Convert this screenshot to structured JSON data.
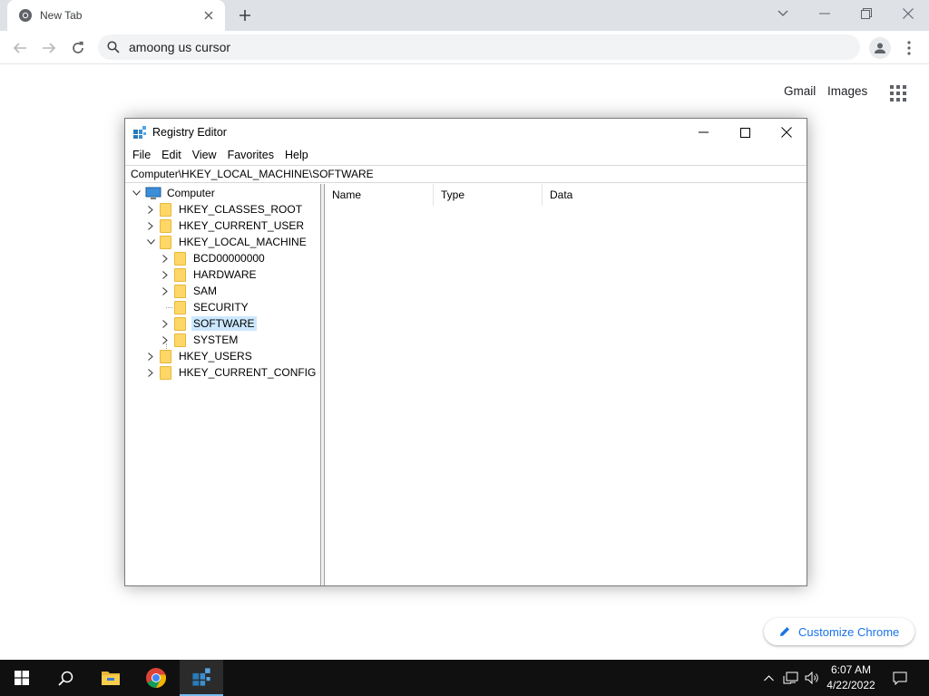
{
  "browser": {
    "tab_title": "New Tab",
    "omnibox_text": "amoong us cursor",
    "ntp": {
      "gmail": "Gmail",
      "images": "Images",
      "customize": "Customize Chrome"
    }
  },
  "regedit": {
    "title": "Registry Editor",
    "menu": [
      "File",
      "Edit",
      "View",
      "Favorites",
      "Help"
    ],
    "address": "Computer\\HKEY_LOCAL_MACHINE\\SOFTWARE",
    "tree": {
      "root": "Computer",
      "hives": {
        "classes_root": "HKEY_CLASSES_ROOT",
        "current_user": "HKEY_CURRENT_USER",
        "local_machine": "HKEY_LOCAL_MACHINE",
        "users": "HKEY_USERS",
        "current_config": "HKEY_CURRENT_CONFIG"
      },
      "hklm_children": [
        "BCD00000000",
        "HARDWARE",
        "SAM",
        "SECURITY",
        "SOFTWARE",
        "SYSTEM"
      ],
      "selected": "SOFTWARE"
    },
    "columns": [
      "Name",
      "Type",
      "Data"
    ]
  },
  "taskbar": {
    "time": "6:07 AM",
    "date": "4/22/2022"
  }
}
